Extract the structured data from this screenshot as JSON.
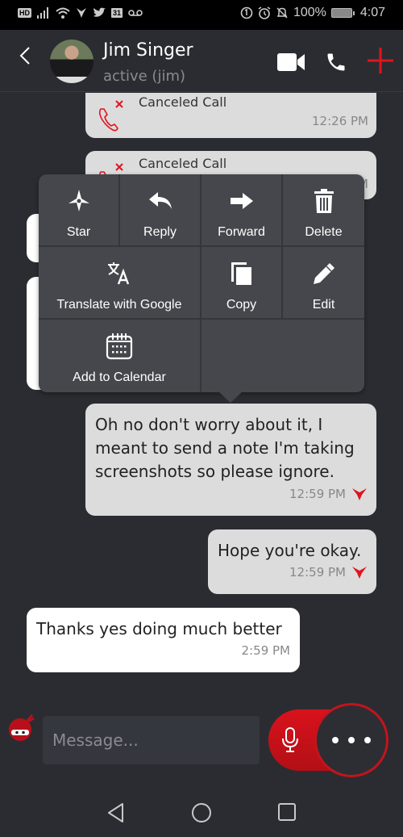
{
  "status_bar": {
    "left_badges": [
      "HD",
      "31"
    ],
    "battery": "100%",
    "time": "4:07"
  },
  "header": {
    "contact_name": "Jim Singer",
    "contact_status": "active (jim)",
    "accent_color": "#e0141e"
  },
  "messages": [
    {
      "type": "call",
      "direction": "out",
      "label": "Canceled Call",
      "time": "12:26 PM"
    },
    {
      "type": "call",
      "direction": "out",
      "label": "Canceled Call",
      "time": "12:26 PM"
    },
    {
      "type": "text",
      "direction": "in",
      "text": "",
      "time": ""
    },
    {
      "type": "text",
      "direction": "in",
      "text": "",
      "time": ""
    },
    {
      "type": "text",
      "direction": "out",
      "lines": [
        "Oh no don't worry about it, I",
        "meant to send a note I'm taking",
        "screenshots so please ignore."
      ],
      "time": "12:59 PM"
    },
    {
      "type": "text",
      "direction": "out",
      "text": "Hope you're okay.",
      "time": "12:59 PM"
    },
    {
      "type": "text",
      "direction": "in",
      "text": "Thanks yes doing much better",
      "time": "2:59 PM"
    }
  ],
  "context_menu": {
    "items": [
      {
        "label": "Star",
        "icon": "star-icon"
      },
      {
        "label": "Reply",
        "icon": "reply-icon"
      },
      {
        "label": "Forward",
        "icon": "forward-icon"
      },
      {
        "label": "Delete",
        "icon": "trash-icon"
      },
      {
        "label": "Translate with Google",
        "icon": "translate-icon"
      },
      {
        "label": "Copy",
        "icon": "copy-icon"
      },
      {
        "label": "Edit",
        "icon": "pencil-icon"
      },
      {
        "label": "Add to Calendar",
        "icon": "calendar-icon"
      }
    ]
  },
  "composer": {
    "placeholder": "Message..."
  }
}
